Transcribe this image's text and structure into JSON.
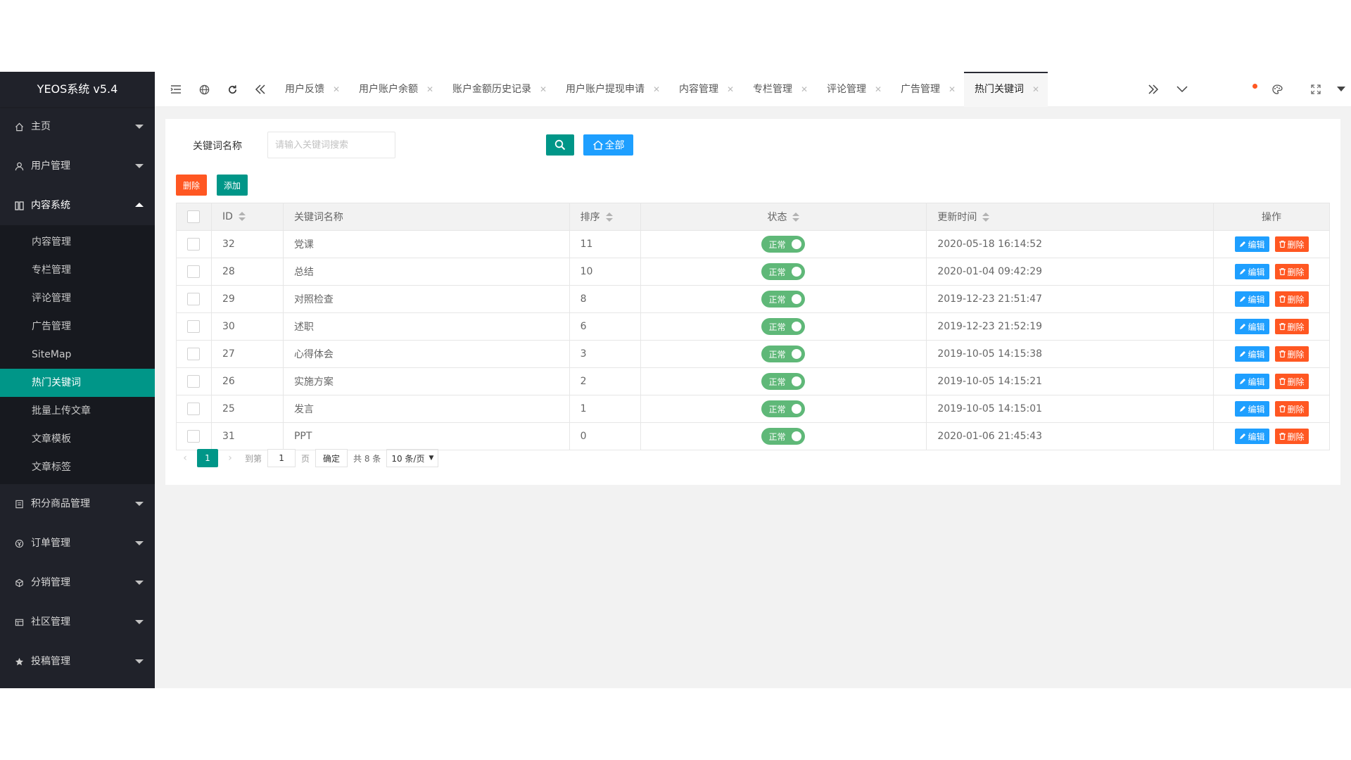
{
  "app_title": "YEOS系统 v5.4",
  "sidebar": {
    "menus_top": [
      {
        "label": "主页",
        "icon": "home-icon"
      },
      {
        "label": "用户管理",
        "icon": "user-icon"
      }
    ],
    "content_menu": {
      "label": "内容系统",
      "icon": "content-icon"
    },
    "sub_items": [
      "内容管理",
      "专栏管理",
      "评论管理",
      "广告管理",
      "SiteMap",
      "热门关键词",
      "批量上传文章",
      "文章模板",
      "文章标签"
    ],
    "active_sub": "热门关键词",
    "menus_bottom": [
      {
        "label": "积分商品管理",
        "icon": "points-icon"
      },
      {
        "label": "订单管理",
        "icon": "order-icon"
      },
      {
        "label": "分销管理",
        "icon": "distribution-icon"
      },
      {
        "label": "社区管理",
        "icon": "community-icon"
      },
      {
        "label": "投稿管理",
        "icon": "star-icon"
      }
    ]
  },
  "tabs": [
    "用户反馈",
    "用户账户余额",
    "账户金额历史记录",
    "用户账户提现申请",
    "内容管理",
    "专栏管理",
    "评论管理",
    "广告管理",
    "热门关键词"
  ],
  "active_tab": "热门关键词",
  "search": {
    "label": "关键词名称",
    "placeholder": "请输入关键词搜索",
    "all_label": "全部"
  },
  "toolbar": {
    "delete_label": "删除",
    "add_label": "添加"
  },
  "table": {
    "headers": {
      "id": "ID",
      "name": "关键词名称",
      "sort": "排序",
      "status": "状态",
      "updated": "更新时间",
      "ops": "操作"
    },
    "rows": [
      {
        "id": "32",
        "name": "党课",
        "sort": "11",
        "status": "正常",
        "updated": "2020-05-18 16:14:52"
      },
      {
        "id": "28",
        "name": "总结",
        "sort": "10",
        "status": "正常",
        "updated": "2020-01-04 09:42:29"
      },
      {
        "id": "29",
        "name": "对照检查",
        "sort": "8",
        "status": "正常",
        "updated": "2019-12-23 21:51:47"
      },
      {
        "id": "30",
        "name": "述职",
        "sort": "6",
        "status": "正常",
        "updated": "2019-12-23 21:52:19"
      },
      {
        "id": "27",
        "name": "心得体会",
        "sort": "3",
        "status": "正常",
        "updated": "2019-10-05 14:15:38"
      },
      {
        "id": "26",
        "name": "实施方案",
        "sort": "2",
        "status": "正常",
        "updated": "2019-10-05 14:15:21"
      },
      {
        "id": "25",
        "name": "发言",
        "sort": "1",
        "status": "正常",
        "updated": "2019-10-05 14:15:01"
      },
      {
        "id": "31",
        "name": "PPT",
        "sort": "0",
        "status": "正常",
        "updated": "2020-01-06 21:45:43"
      }
    ],
    "edit_label": "编辑",
    "delete_label": "删除"
  },
  "pager": {
    "current": "1",
    "goto_label": "到第",
    "page_input": "1",
    "page_unit": "页",
    "confirm_label": "确定",
    "total_label": "共 8 条",
    "size_label": "10 条/页"
  },
  "colors": {
    "accent": "#009688",
    "sidebar": "#20222a",
    "danger": "#ff5722",
    "info": "#1e9fff",
    "switch_on": "#5fb878"
  }
}
